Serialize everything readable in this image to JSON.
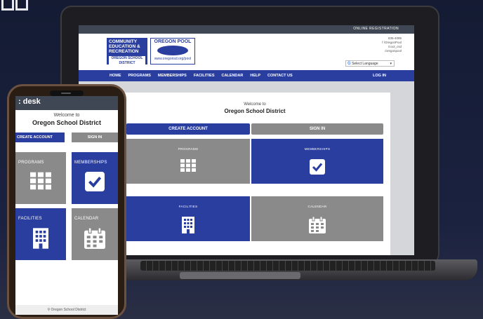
{
  "colors": {
    "brand_blue": "#2a3ea0",
    "tile_gray": "#8a8a8a",
    "header_dark": "#3f4654",
    "background": "#1b2240"
  },
  "laptop": {
    "topbar_link": "ONLINE REGISTRATION",
    "logo_left": {
      "line1": "COMMUNITY",
      "line2": "EDUCATION &",
      "line3": "RECREATION",
      "district": "OREGON SCHOOL DISTRICT"
    },
    "logo_right": {
      "title": "OREGON POOL",
      "url": "www.oregonsd.org/pool"
    },
    "contact": [
      "835-4095",
      "f /OregonPool",
      "/cool_csd",
      "/oregonpool"
    ],
    "language_select": "Select Language",
    "nav": {
      "items": [
        "HOME",
        "PROGRAMS",
        "MEMBERSHIPS",
        "FACILITIES",
        "CALENDAR",
        "HELP",
        "CONTACT US"
      ],
      "login": "LOG IN"
    },
    "welcome": "Welcome to",
    "district_name": "Oregon School District",
    "create_account": "CREATE ACCOUNT",
    "sign_in": "SIGN IN",
    "tiles": [
      {
        "label": "PROGRAMS",
        "icon": "grid-icon",
        "color": "gray"
      },
      {
        "label": "MEMBERSHIPS",
        "icon": "checkbox-icon",
        "color": "blue"
      },
      {
        "label": "FACILITIES",
        "icon": "building-icon",
        "color": "blue"
      },
      {
        "label": "CALENDAR",
        "icon": "calendar-icon",
        "color": "gray"
      }
    ]
  },
  "phone": {
    "header_title": ": desk",
    "welcome": "Welcome to",
    "district_name": "Oregon School District",
    "create_account": "CREATE ACCOUNT",
    "sign_in": "SIGN IN",
    "tiles": [
      {
        "label": "PROGRAMS",
        "icon": "grid-icon",
        "color": "gray"
      },
      {
        "label": "MEMBERSHIPS",
        "icon": "checkbox-icon",
        "color": "blue"
      },
      {
        "label": "FACILITIES",
        "icon": "building-icon",
        "color": "blue"
      },
      {
        "label": "CALENDAR",
        "icon": "calendar-icon",
        "color": "gray"
      }
    ],
    "footer": "Oregon School District"
  }
}
